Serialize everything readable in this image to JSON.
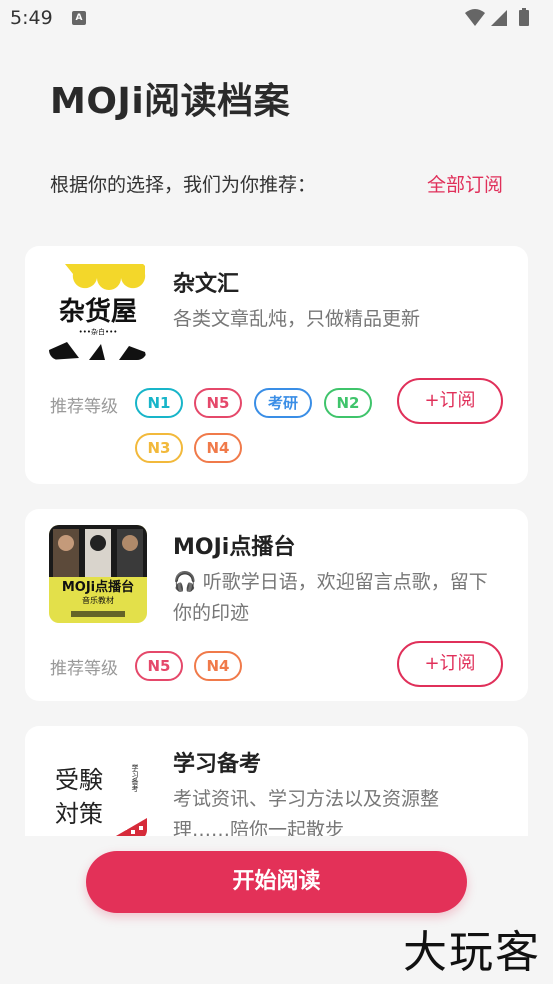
{
  "status_bar": {
    "time": "5:49",
    "notification_icon": "A",
    "icons": [
      "wifi-icon",
      "signal-icon",
      "battery-icon"
    ]
  },
  "page": {
    "title": "MOJi阅读档案",
    "subtitle": "根据你的选择，我们为你推荐：",
    "subscribe_all": "全部订阅"
  },
  "recommend_label": "推荐等级",
  "subscribe_label": "+订阅",
  "cards": [
    {
      "title": "杂文汇",
      "description": "各类文章乱炖，只做精品更新",
      "cover_text": "杂货屋",
      "cover_subtext": "•••杂白•••",
      "tags": [
        {
          "label": "N1",
          "color": "#18b5c9"
        },
        {
          "label": "N5",
          "color": "#e5486a"
        },
        {
          "label": "考研",
          "color": "#3a8ee6"
        },
        {
          "label": "N2",
          "color": "#3fc46b"
        },
        {
          "label": "N3",
          "color": "#f2b93b"
        },
        {
          "label": "N4",
          "color": "#f07a4a"
        }
      ]
    },
    {
      "title": "MOJi点播台",
      "description": "🎧 听歌学日语，欢迎留言点歌，留下你的印迹",
      "cover_text": "MOJi点播台",
      "cover_subtext": "音乐教材",
      "tags": [
        {
          "label": "N5",
          "color": "#e5486a"
        },
        {
          "label": "N4",
          "color": "#f07a4a"
        }
      ]
    },
    {
      "title": "学习备考",
      "description": "考试资讯、学习方法以及资源整理……陪你一起散步",
      "cover_text": "受験対策",
      "cover_subtext": "学习备考",
      "tags": []
    }
  ],
  "start_button": "开始阅读",
  "watermark": "大玩客",
  "colors": {
    "accent": "#e33158",
    "background": "#f5f5f5",
    "card": "#ffffff"
  }
}
